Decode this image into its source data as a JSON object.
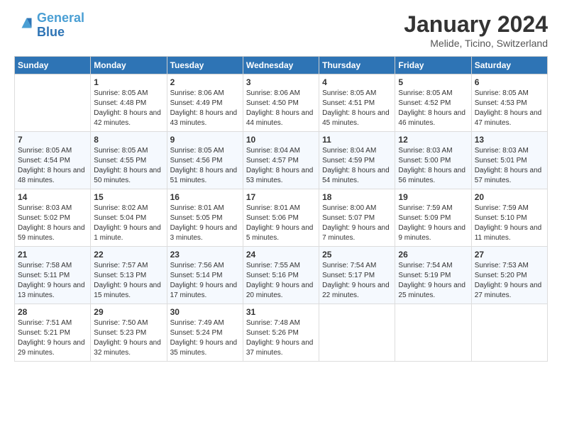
{
  "header": {
    "logo_general": "General",
    "logo_blue": "Blue",
    "title": "January 2024",
    "location": "Melide, Ticino, Switzerland"
  },
  "days_of_week": [
    "Sunday",
    "Monday",
    "Tuesday",
    "Wednesday",
    "Thursday",
    "Friday",
    "Saturday"
  ],
  "weeks": [
    [
      {
        "day": "",
        "sunrise": "",
        "sunset": "",
        "daylight": ""
      },
      {
        "day": "1",
        "sunrise": "Sunrise: 8:05 AM",
        "sunset": "Sunset: 4:48 PM",
        "daylight": "Daylight: 8 hours and 42 minutes."
      },
      {
        "day": "2",
        "sunrise": "Sunrise: 8:06 AM",
        "sunset": "Sunset: 4:49 PM",
        "daylight": "Daylight: 8 hours and 43 minutes."
      },
      {
        "day": "3",
        "sunrise": "Sunrise: 8:06 AM",
        "sunset": "Sunset: 4:50 PM",
        "daylight": "Daylight: 8 hours and 44 minutes."
      },
      {
        "day": "4",
        "sunrise": "Sunrise: 8:05 AM",
        "sunset": "Sunset: 4:51 PM",
        "daylight": "Daylight: 8 hours and 45 minutes."
      },
      {
        "day": "5",
        "sunrise": "Sunrise: 8:05 AM",
        "sunset": "Sunset: 4:52 PM",
        "daylight": "Daylight: 8 hours and 46 minutes."
      },
      {
        "day": "6",
        "sunrise": "Sunrise: 8:05 AM",
        "sunset": "Sunset: 4:53 PM",
        "daylight": "Daylight: 8 hours and 47 minutes."
      }
    ],
    [
      {
        "day": "7",
        "sunrise": "Sunrise: 8:05 AM",
        "sunset": "Sunset: 4:54 PM",
        "daylight": "Daylight: 8 hours and 48 minutes."
      },
      {
        "day": "8",
        "sunrise": "Sunrise: 8:05 AM",
        "sunset": "Sunset: 4:55 PM",
        "daylight": "Daylight: 8 hours and 50 minutes."
      },
      {
        "day": "9",
        "sunrise": "Sunrise: 8:05 AM",
        "sunset": "Sunset: 4:56 PM",
        "daylight": "Daylight: 8 hours and 51 minutes."
      },
      {
        "day": "10",
        "sunrise": "Sunrise: 8:04 AM",
        "sunset": "Sunset: 4:57 PM",
        "daylight": "Daylight: 8 hours and 53 minutes."
      },
      {
        "day": "11",
        "sunrise": "Sunrise: 8:04 AM",
        "sunset": "Sunset: 4:59 PM",
        "daylight": "Daylight: 8 hours and 54 minutes."
      },
      {
        "day": "12",
        "sunrise": "Sunrise: 8:03 AM",
        "sunset": "Sunset: 5:00 PM",
        "daylight": "Daylight: 8 hours and 56 minutes."
      },
      {
        "day": "13",
        "sunrise": "Sunrise: 8:03 AM",
        "sunset": "Sunset: 5:01 PM",
        "daylight": "Daylight: 8 hours and 57 minutes."
      }
    ],
    [
      {
        "day": "14",
        "sunrise": "Sunrise: 8:03 AM",
        "sunset": "Sunset: 5:02 PM",
        "daylight": "Daylight: 8 hours and 59 minutes."
      },
      {
        "day": "15",
        "sunrise": "Sunrise: 8:02 AM",
        "sunset": "Sunset: 5:04 PM",
        "daylight": "Daylight: 9 hours and 1 minute."
      },
      {
        "day": "16",
        "sunrise": "Sunrise: 8:01 AM",
        "sunset": "Sunset: 5:05 PM",
        "daylight": "Daylight: 9 hours and 3 minutes."
      },
      {
        "day": "17",
        "sunrise": "Sunrise: 8:01 AM",
        "sunset": "Sunset: 5:06 PM",
        "daylight": "Daylight: 9 hours and 5 minutes."
      },
      {
        "day": "18",
        "sunrise": "Sunrise: 8:00 AM",
        "sunset": "Sunset: 5:07 PM",
        "daylight": "Daylight: 9 hours and 7 minutes."
      },
      {
        "day": "19",
        "sunrise": "Sunrise: 7:59 AM",
        "sunset": "Sunset: 5:09 PM",
        "daylight": "Daylight: 9 hours and 9 minutes."
      },
      {
        "day": "20",
        "sunrise": "Sunrise: 7:59 AM",
        "sunset": "Sunset: 5:10 PM",
        "daylight": "Daylight: 9 hours and 11 minutes."
      }
    ],
    [
      {
        "day": "21",
        "sunrise": "Sunrise: 7:58 AM",
        "sunset": "Sunset: 5:11 PM",
        "daylight": "Daylight: 9 hours and 13 minutes."
      },
      {
        "day": "22",
        "sunrise": "Sunrise: 7:57 AM",
        "sunset": "Sunset: 5:13 PM",
        "daylight": "Daylight: 9 hours and 15 minutes."
      },
      {
        "day": "23",
        "sunrise": "Sunrise: 7:56 AM",
        "sunset": "Sunset: 5:14 PM",
        "daylight": "Daylight: 9 hours and 17 minutes."
      },
      {
        "day": "24",
        "sunrise": "Sunrise: 7:55 AM",
        "sunset": "Sunset: 5:16 PM",
        "daylight": "Daylight: 9 hours and 20 minutes."
      },
      {
        "day": "25",
        "sunrise": "Sunrise: 7:54 AM",
        "sunset": "Sunset: 5:17 PM",
        "daylight": "Daylight: 9 hours and 22 minutes."
      },
      {
        "day": "26",
        "sunrise": "Sunrise: 7:54 AM",
        "sunset": "Sunset: 5:19 PM",
        "daylight": "Daylight: 9 hours and 25 minutes."
      },
      {
        "day": "27",
        "sunrise": "Sunrise: 7:53 AM",
        "sunset": "Sunset: 5:20 PM",
        "daylight": "Daylight: 9 hours and 27 minutes."
      }
    ],
    [
      {
        "day": "28",
        "sunrise": "Sunrise: 7:51 AM",
        "sunset": "Sunset: 5:21 PM",
        "daylight": "Daylight: 9 hours and 29 minutes."
      },
      {
        "day": "29",
        "sunrise": "Sunrise: 7:50 AM",
        "sunset": "Sunset: 5:23 PM",
        "daylight": "Daylight: 9 hours and 32 minutes."
      },
      {
        "day": "30",
        "sunrise": "Sunrise: 7:49 AM",
        "sunset": "Sunset: 5:24 PM",
        "daylight": "Daylight: 9 hours and 35 minutes."
      },
      {
        "day": "31",
        "sunrise": "Sunrise: 7:48 AM",
        "sunset": "Sunset: 5:26 PM",
        "daylight": "Daylight: 9 hours and 37 minutes."
      },
      {
        "day": "",
        "sunrise": "",
        "sunset": "",
        "daylight": ""
      },
      {
        "day": "",
        "sunrise": "",
        "sunset": "",
        "daylight": ""
      },
      {
        "day": "",
        "sunrise": "",
        "sunset": "",
        "daylight": ""
      }
    ]
  ]
}
